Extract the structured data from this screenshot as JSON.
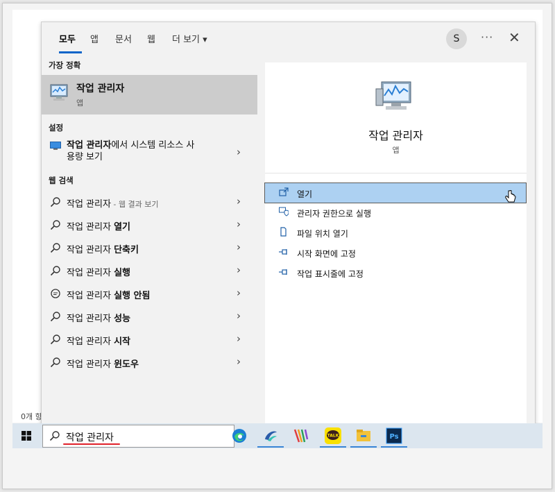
{
  "tabs": [
    {
      "label": "모두",
      "active": true
    },
    {
      "label": "앱"
    },
    {
      "label": "문서"
    },
    {
      "label": "웹"
    },
    {
      "label": "더 보기 ▾"
    }
  ],
  "avatar_letter": "S",
  "more_label": "···",
  "close_label": "✕",
  "sections": {
    "best_match": "가장 정확",
    "settings": "설정",
    "web_search": "웹 검색"
  },
  "best_match_item": {
    "title": "작업 관리자",
    "subtitle": "앱"
  },
  "settings_item": {
    "bold": "작업 관리자",
    "line1_rest": "에서 시스템 리소스 사",
    "line2": "용량 보기"
  },
  "web_items": [
    {
      "normal": "작업 관리자",
      "bold": "",
      "hint": " - 웹 결과 보기",
      "icon": "search-icon"
    },
    {
      "normal": "작업 관리자 ",
      "bold": "열기",
      "hint": "",
      "icon": "search-icon"
    },
    {
      "normal": "작업 관리자 ",
      "bold": "단축키",
      "hint": "",
      "icon": "search-icon"
    },
    {
      "normal": "작업 관리자 ",
      "bold": "실행",
      "hint": "",
      "icon": "search-icon"
    },
    {
      "normal": "작업 관리자 ",
      "bold": "실행 안됨",
      "hint": "",
      "icon": "chat-icon"
    },
    {
      "normal": "작업 관리자 ",
      "bold": "성능",
      "hint": "",
      "icon": "search-icon"
    },
    {
      "normal": "작업 관리자 ",
      "bold": "시작",
      "hint": "",
      "icon": "search-icon"
    },
    {
      "normal": "작업 관리자 ",
      "bold": "윈도우",
      "hint": "",
      "icon": "search-icon"
    }
  ],
  "chevron": "›",
  "detail": {
    "name": "작업 관리자",
    "type": "앱"
  },
  "actions": [
    {
      "label": "열기",
      "icon": "open-icon",
      "highlighted": true
    },
    {
      "label": "관리자 권한으로 실행",
      "icon": "shield-icon"
    },
    {
      "label": "파일 위치 열기",
      "icon": "file-location-icon"
    },
    {
      "label": "시작 화면에 고정",
      "icon": "pin-icon"
    },
    {
      "label": "작업 표시줄에 고정",
      "icon": "pin-icon"
    }
  ],
  "side_label": "0개 항",
  "search_query": "작업 관리자",
  "taskbar_apps": [
    "edge-icon",
    "app2-icon",
    "app3-icon",
    "kakaotalk-icon",
    "file-explorer-icon",
    "photoshop-icon"
  ],
  "kakao_label": "TALK",
  "ps_label": "Ps",
  "colors": {
    "accent": "#0a64c8",
    "highlight": "#add1f2",
    "underline_red": "#e0202a"
  }
}
